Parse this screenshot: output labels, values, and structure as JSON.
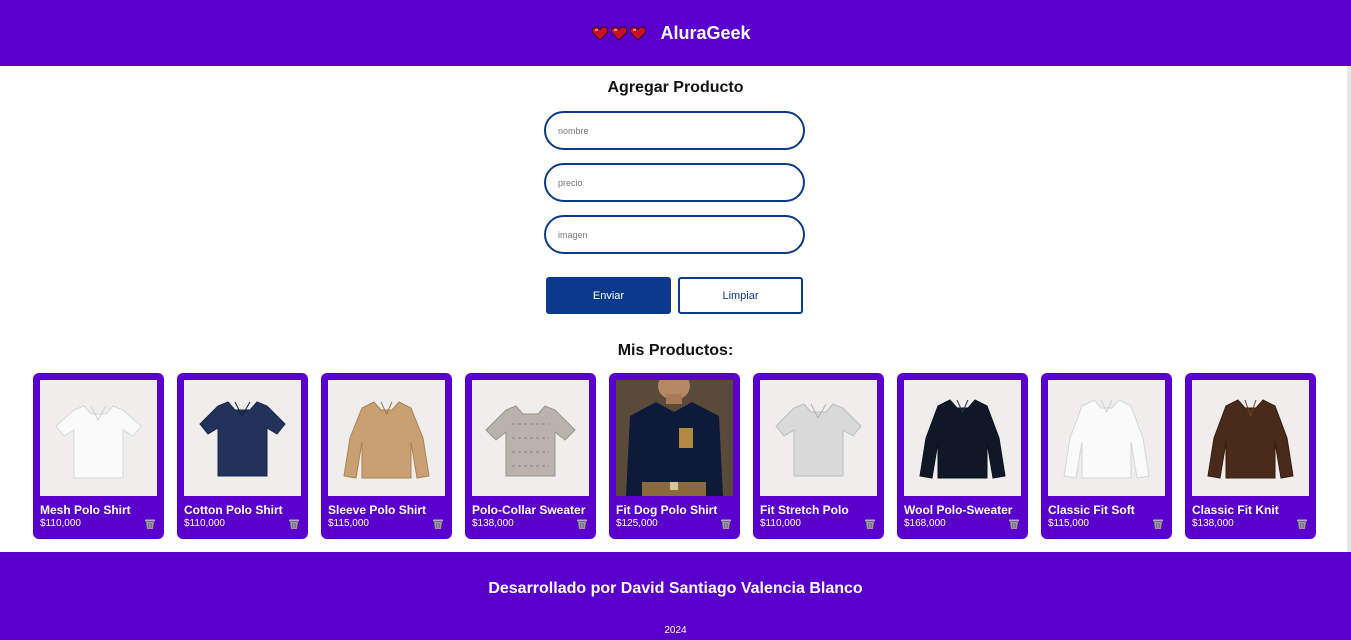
{
  "header": {
    "brand": "AluraGeek",
    "heart_color": "#c8102e"
  },
  "form": {
    "title": "Agregar Producto",
    "name_placeholder": "nombre",
    "price_placeholder": "precio",
    "image_placeholder": "imagen",
    "submit_label": "Enviar",
    "clear_label": "Limpiar"
  },
  "products_section": {
    "title": "Mis Productos:",
    "items": [
      {
        "name": "Mesh Polo Shirt",
        "price": "$110,000",
        "image": "white-polo"
      },
      {
        "name": "Cotton Polo Shirt",
        "price": "$110,000",
        "image": "navy-polo"
      },
      {
        "name": "Sleeve Polo Shirt",
        "price": "$115,000",
        "image": "tan-long-sleeve-polo"
      },
      {
        "name": "Polo-Collar Sweater",
        "price": "$138,000",
        "image": "grey-knit-polo"
      },
      {
        "name": "Fit Dog Polo Shirt",
        "price": "$125,000",
        "image": "navy-polo-on-model"
      },
      {
        "name": "Fit Stretch Polo",
        "price": "$110,000",
        "image": "light-grey-polo"
      },
      {
        "name": "Wool Polo-Sweater",
        "price": "$168,000",
        "image": "black-long-sleeve-polo"
      },
      {
        "name": "Classic Fit Soft",
        "price": "$115,000",
        "image": "white-long-sleeve-polo"
      },
      {
        "name": "Classic Fit Knit",
        "price": "$138,000",
        "image": "brown-knit-polo"
      }
    ]
  },
  "footer": {
    "credit": "Desarrollado por David Santiago Valencia Blanco",
    "year": "2024"
  },
  "colors": {
    "brand": "#5a00cc",
    "accent": "#0b3a8c"
  }
}
